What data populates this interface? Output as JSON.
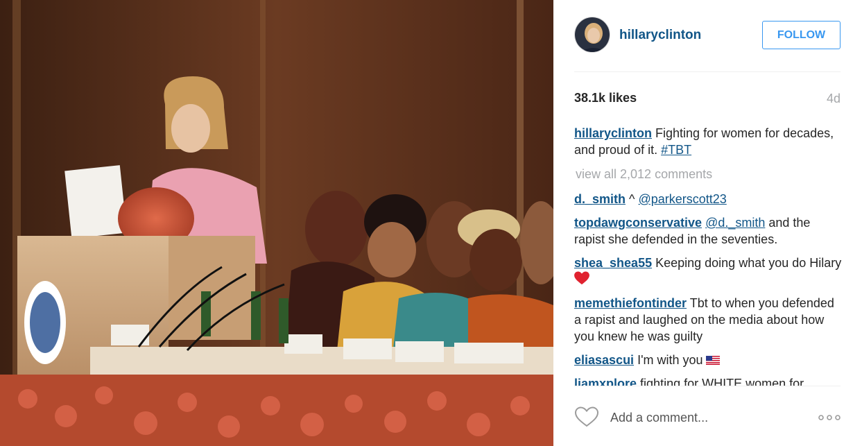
{
  "post": {
    "username": "hillaryclinton",
    "follow_label": "FOLLOW",
    "likes": "38.1k likes",
    "age": "4d",
    "caption": {
      "author": "hillaryclinton",
      "text_before": " Fighting for women for decades, and proud of it. ",
      "hashtag": "#TBT"
    },
    "view_all": "view all 2,012 comments",
    "comments": [
      {
        "author": "d._smith",
        "text": " ^ ",
        "mention": "@parkerscott23",
        "text_after": ""
      },
      {
        "author": "topdawgconservative",
        "text": " ",
        "mention": "@d._smith",
        "text_after": " and the rapist she defended in the seventies."
      },
      {
        "author": "shea_shea55",
        "text": " Keeping doing what you do Hilary"
      },
      {
        "author": "memethiefontinder",
        "text": " Tbt to when you defended a rapist and laughed on the media about how you knew he was guilty"
      },
      {
        "author": "eliasascui",
        "text": " I'm with you"
      },
      {
        "author": "liamxplore",
        "text": " fighting for WHITE women for"
      }
    ],
    "add_comment_placeholder": "Add a comment..."
  },
  "icons": {
    "like": "heart-outline-icon",
    "more": "more-options-icon",
    "flag": "us-flag-emoji",
    "red_heart": "red-heart-emoji"
  },
  "colors": {
    "username": "#125688",
    "follow_border": "#3897f0",
    "muted": "#a5a7aa"
  }
}
